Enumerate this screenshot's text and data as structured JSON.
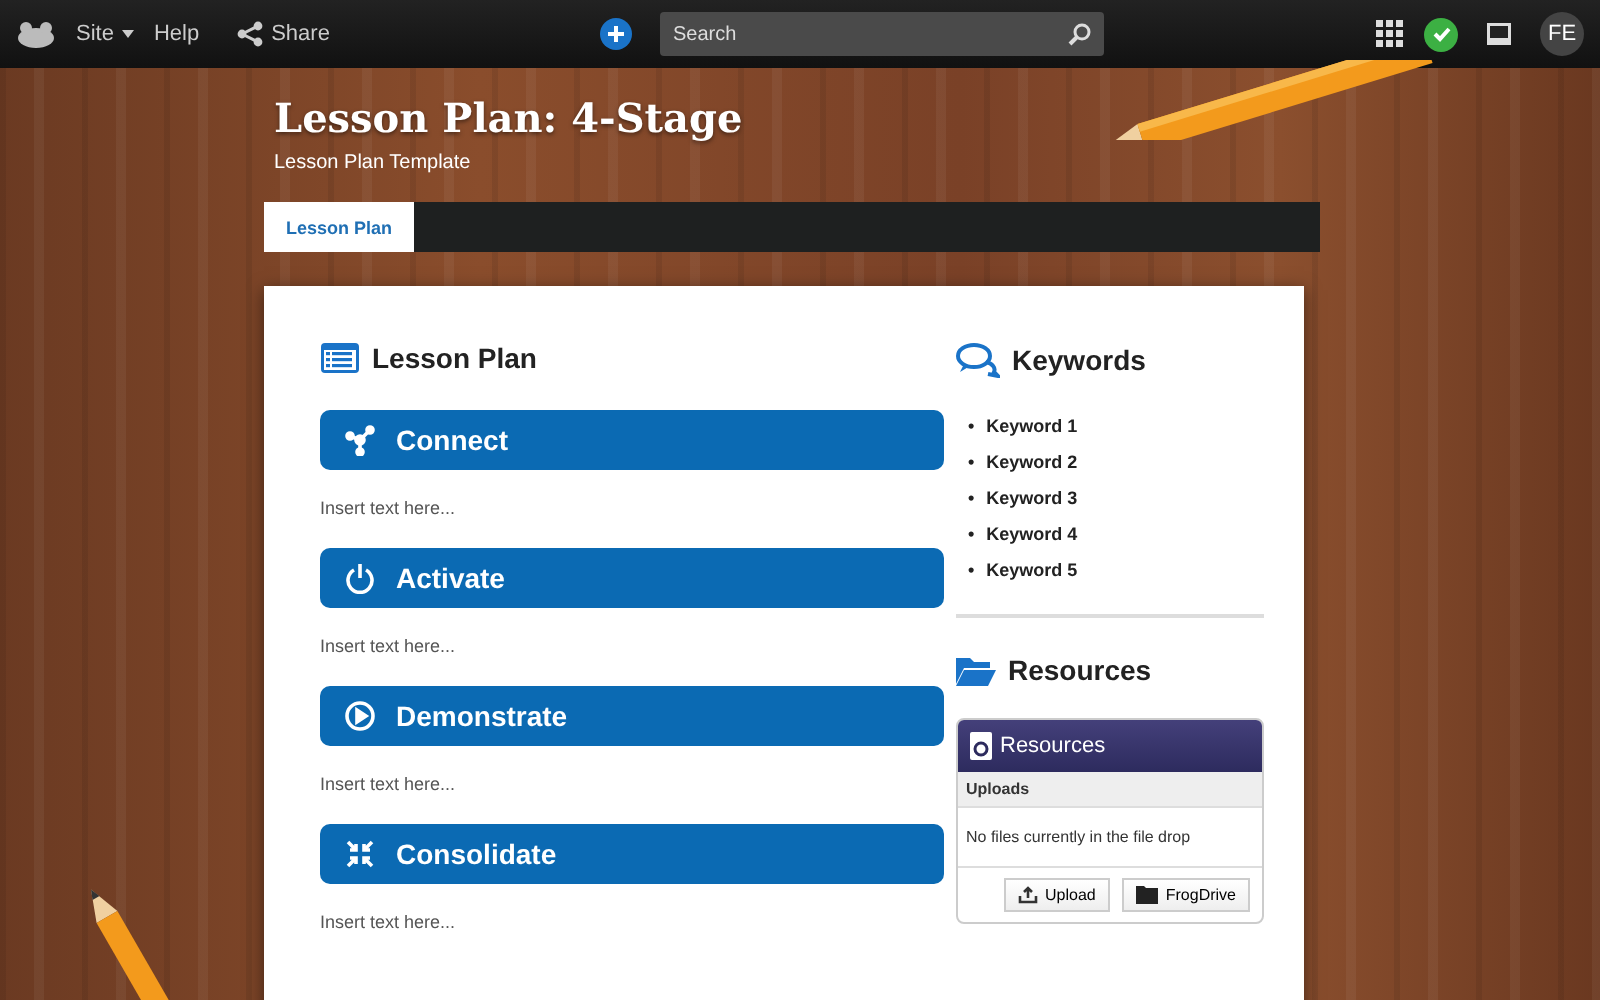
{
  "topbar": {
    "site_menu": "Site",
    "help": "Help",
    "share": "Share",
    "search": {
      "placeholder": "Search"
    },
    "status_ok": true,
    "avatar": "FE"
  },
  "header": {
    "title": "Lesson Plan: 4-Stage",
    "subtitle": "Lesson Plan Template"
  },
  "tabs": [
    {
      "label": "Lesson Plan",
      "selected": true
    }
  ],
  "lesson_plan": {
    "heading": "Lesson Plan",
    "stages": [
      {
        "kind": "connect",
        "title": "Connect",
        "body": "Insert text here..."
      },
      {
        "kind": "activate",
        "title": "Activate",
        "body": "Insert text here..."
      },
      {
        "kind": "demonstrate",
        "title": "Demonstrate",
        "body": "Insert text here..."
      },
      {
        "kind": "consolidate",
        "title": "Consolidate",
        "body": "Insert text here..."
      }
    ]
  },
  "keywords": {
    "heading": "Keywords",
    "items": [
      {
        "marker": "•",
        "label": "Keyword 1"
      },
      {
        "marker": "•",
        "label": "Keyword 2"
      },
      {
        "marker": "•",
        "label": "Keyword 3"
      },
      {
        "marker": "•",
        "label": "Keyword 4"
      },
      {
        "marker": "•",
        "label": "Keyword 5"
      }
    ]
  },
  "resources": {
    "heading": "Resources",
    "widget_title": "Resources",
    "section": "Uploads",
    "empty_message": "No files currently in the file drop",
    "buttons": [
      "Upload",
      "FrogDrive"
    ]
  }
}
